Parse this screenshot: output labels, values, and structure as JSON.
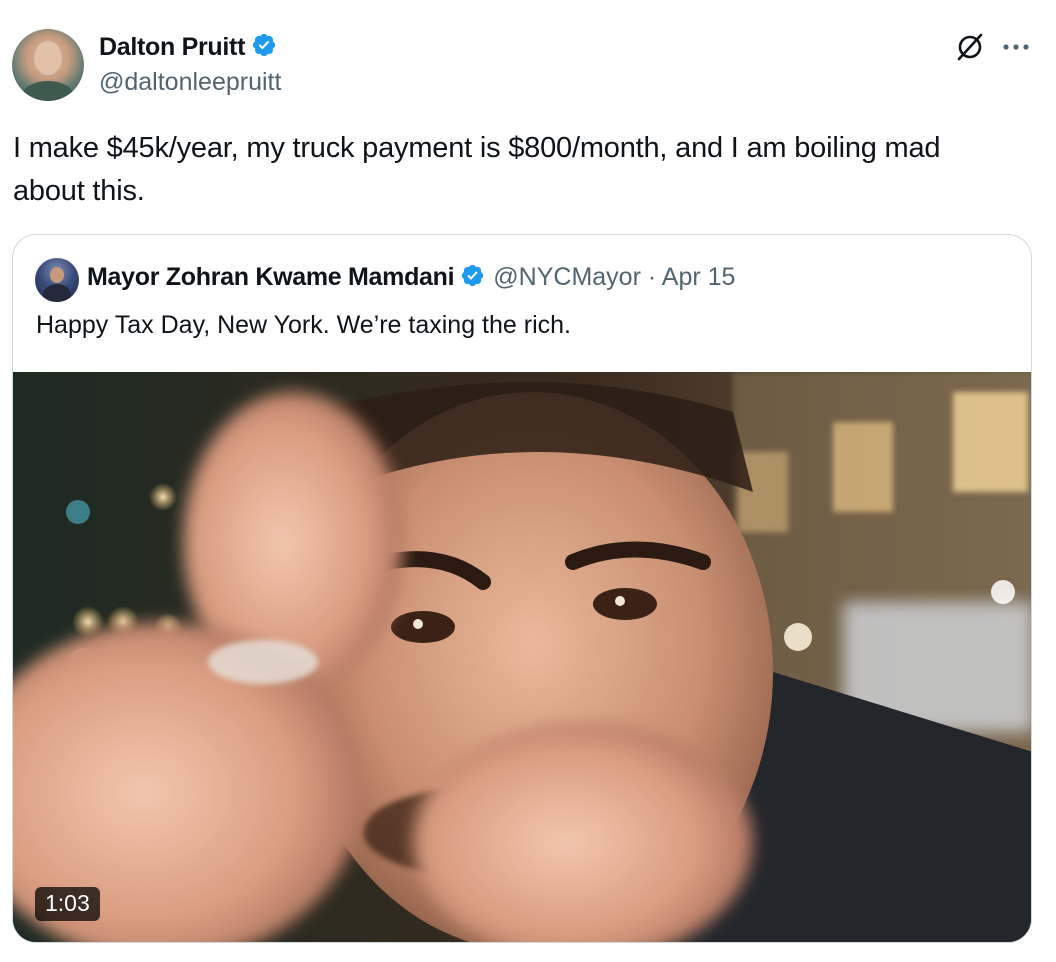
{
  "tweet": {
    "author": {
      "name": "Dalton Pruitt",
      "handle": "@daltonleepruitt",
      "verified": true,
      "verified_color": "#1d9bf0"
    },
    "text": "I make $45k/year, my truck payment is $800/month, and I am boiling mad about this.",
    "actions": {
      "grok_icon": "grok-icon",
      "more_icon": "more-icon"
    }
  },
  "quoted_tweet": {
    "author": {
      "name": "Mayor Zohran Kwame Mamdani",
      "handle": "@NYCMayor",
      "verified": true
    },
    "separator": "·",
    "date": "Apr 15",
    "text": "Happy Tax Day, New York. We’re taxing the rich.",
    "media": {
      "type": "video",
      "duration": "1:03"
    }
  }
}
